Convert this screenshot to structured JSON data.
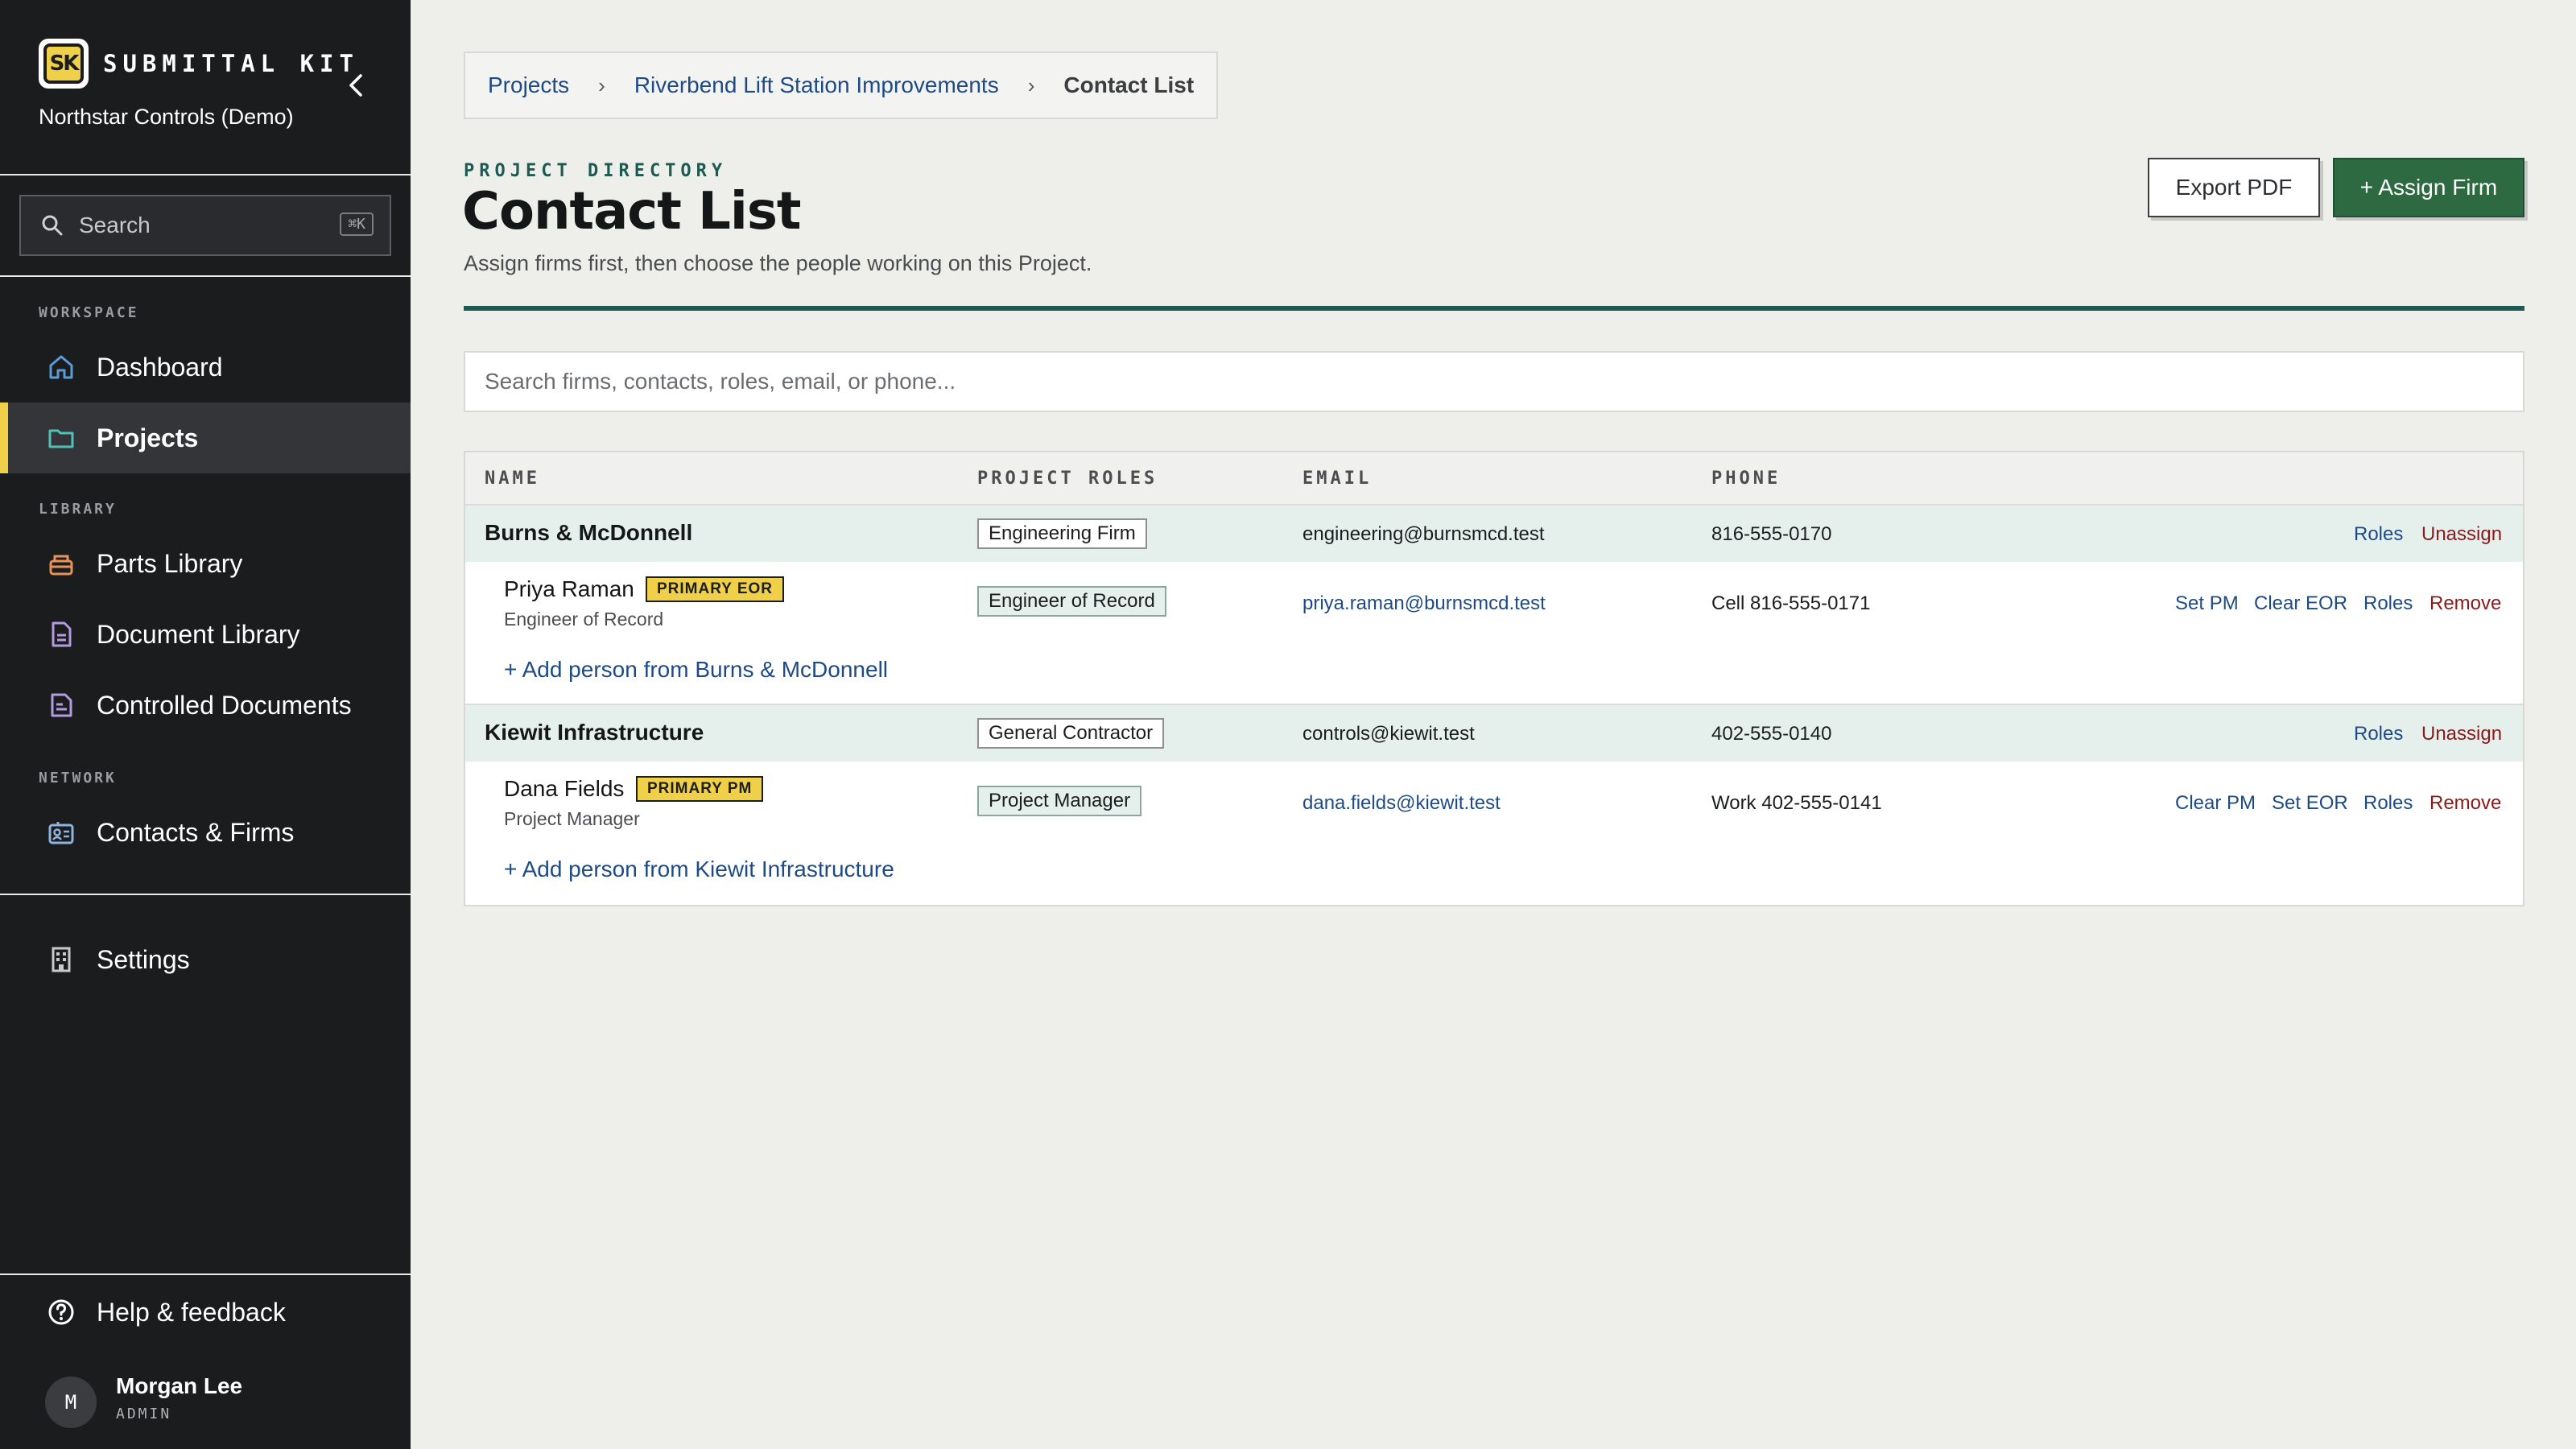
{
  "app": {
    "logo_text": "SK",
    "name": "SUBMITTAL KIT",
    "org": "Northstar Controls (Demo)"
  },
  "sidebar": {
    "search_label": "Search",
    "search_shortcut": "⌘K",
    "sections": {
      "workspace": "WORKSPACE",
      "library": "LIBRARY",
      "network": "NETWORK"
    },
    "items": [
      {
        "label": "Dashboard",
        "icon": "home-icon",
        "active": false
      },
      {
        "label": "Projects",
        "icon": "folder-icon",
        "active": true
      },
      {
        "label": "Parts Library",
        "icon": "parts-box-icon",
        "active": false
      },
      {
        "label": "Document Library",
        "icon": "document-icon",
        "active": false
      },
      {
        "label": "Controlled Documents",
        "icon": "controlled-document-icon",
        "active": false
      },
      {
        "label": "Contacts & Firms",
        "icon": "contact-card-icon",
        "active": false
      },
      {
        "label": "Settings",
        "icon": "building-icon",
        "active": false
      }
    ],
    "help_label": "Help & feedback",
    "user": {
      "initial": "M",
      "name": "Morgan Lee",
      "role": "ADMIN"
    }
  },
  "breadcrumb": {
    "items": [
      "Projects",
      "Riverbend Lift Station Improvements"
    ],
    "current": "Contact List"
  },
  "header": {
    "eyebrow": "PROJECT DIRECTORY",
    "title": "Contact List",
    "subtitle": "Assign firms first, then choose the people working on this Project.",
    "export_label": "Export PDF",
    "assign_label": "+ Assign Firm"
  },
  "filter": {
    "placeholder": "Search firms, contacts, roles, email, or phone..."
  },
  "table": {
    "columns": [
      "NAME",
      "PROJECT ROLES",
      "EMAIL",
      "PHONE"
    ],
    "firms": [
      {
        "name": "Burns & McDonnell",
        "role": "Engineering Firm",
        "email": "engineering@burnsmcd.test",
        "phone": "816-555-0170",
        "actions": [
          "Roles",
          "Unassign"
        ],
        "person": {
          "name": "Priya Raman",
          "badge": "PRIMARY EOR",
          "title": "Engineer of Record",
          "role": "Engineer of Record",
          "email": "priya.raman@burnsmcd.test",
          "phone": "Cell 816-555-0171",
          "actions": [
            "Set PM",
            "Clear EOR",
            "Roles",
            "Remove"
          ]
        },
        "add_person": "+ Add person from Burns & McDonnell"
      },
      {
        "name": "Kiewit Infrastructure",
        "role": "General Contractor",
        "email": "controls@kiewit.test",
        "phone": "402-555-0140",
        "actions": [
          "Roles",
          "Unassign"
        ],
        "person": {
          "name": "Dana Fields",
          "badge": "PRIMARY PM",
          "title": "Project Manager",
          "role": "Project Manager",
          "email": "dana.fields@kiewit.test",
          "phone": "Work 402-555-0141",
          "actions": [
            "Clear PM",
            "Set EOR",
            "Roles",
            "Remove"
          ]
        },
        "add_person": "+ Add person from Kiewit Infrastructure"
      }
    ]
  },
  "colors": {
    "sidebar_bg": "#1b1c1e",
    "accent_yellow": "#f1d049",
    "teal": "#1d5b52",
    "primary_green": "#2d6a41",
    "link_blue": "#1e4b86",
    "danger_red": "#8b1a1a"
  }
}
